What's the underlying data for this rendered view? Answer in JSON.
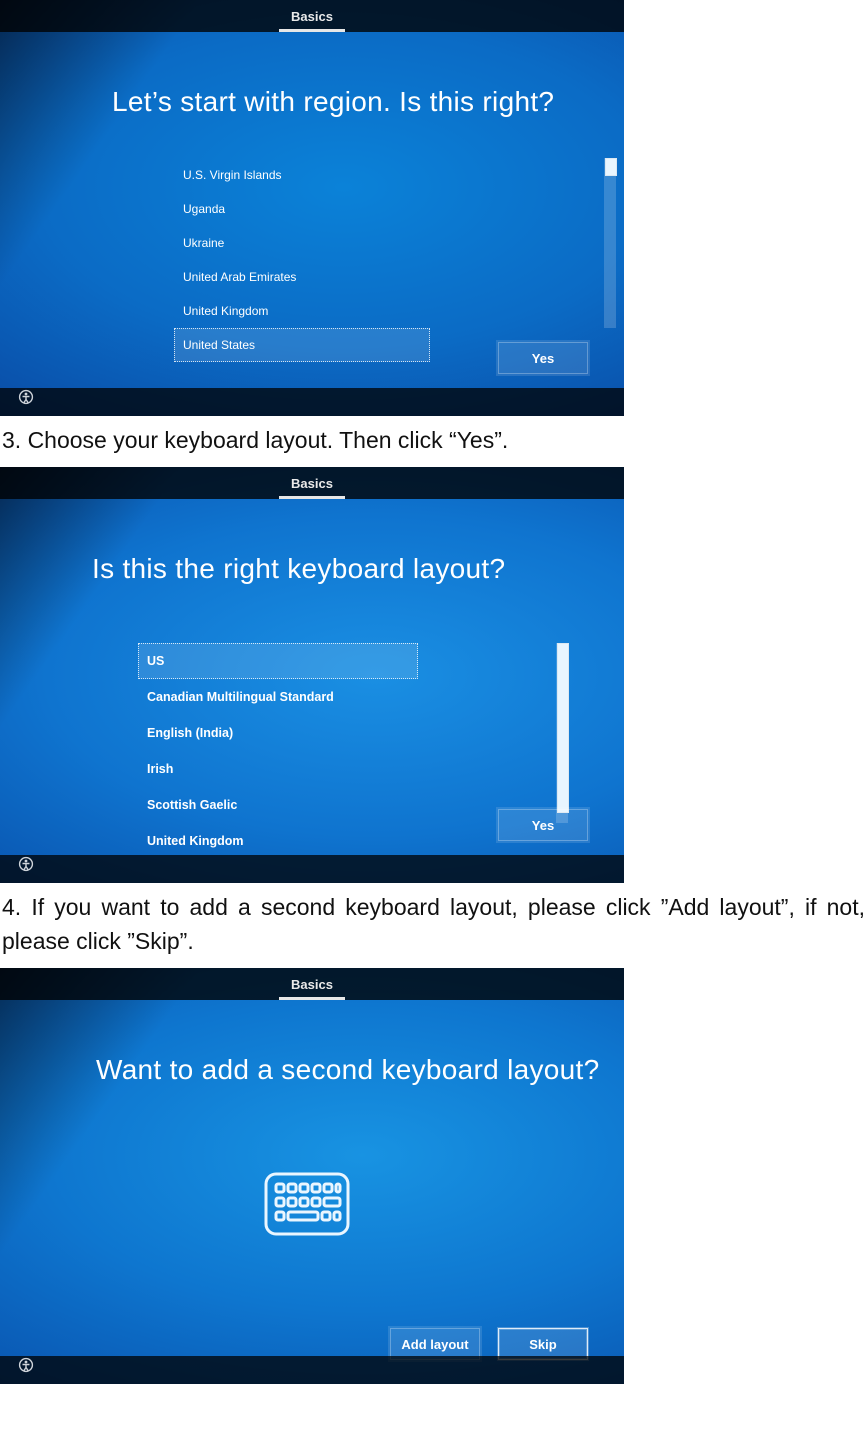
{
  "instructions": {
    "step3": "3. Choose your keyboard layout. Then click “Yes”.",
    "step4": "4. If you want to add a second keyboard layout, please click ”Add layout”, if not, please click ”Skip”."
  },
  "oobe": {
    "tab_label": "Basics"
  },
  "screen_region": {
    "heading": "Let’s start with region. Is this right?",
    "items": [
      "U.S. Virgin Islands",
      "Uganda",
      "Ukraine",
      "United Arab Emirates",
      "United Kingdom",
      "United States"
    ],
    "selected_index": 5,
    "yes_label": "Yes"
  },
  "screen_keyboard": {
    "heading": "Is this the right keyboard layout?",
    "items": [
      "US",
      "Canadian Multilingual Standard",
      "English (India)",
      "Irish",
      "Scottish Gaelic",
      "United Kingdom"
    ],
    "selected_index": 0,
    "yes_label": "Yes"
  },
  "screen_second_layout": {
    "heading": "Want to add a second keyboard layout?",
    "add_label": "Add layout",
    "skip_label": "Skip"
  }
}
